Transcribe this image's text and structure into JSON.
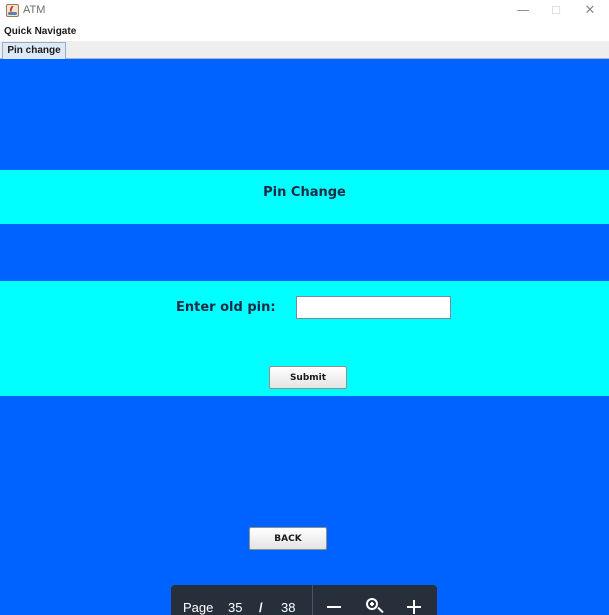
{
  "window": {
    "title": "ATM",
    "minimize_icon": "minimize-icon",
    "maximize_icon": "maximize-icon",
    "close_icon": "close-icon"
  },
  "menu": {
    "items": [
      "Quick Navigate"
    ]
  },
  "tabs": [
    {
      "label": "Pin change",
      "selected": true
    }
  ],
  "page": {
    "heading": "Pin Change",
    "pin_label": "Enter old pin:",
    "pin_value": "",
    "submit_label": "Submit",
    "back_label": "BACK"
  },
  "pdf_toolbar": {
    "page_label": "Page",
    "current_page": "35",
    "separator": "/",
    "total_pages": "38",
    "icons": [
      "zoom-out-icon",
      "zoom-icon",
      "zoom-in-icon"
    ]
  },
  "colors": {
    "background": "#0063ff",
    "band": "#00ffff",
    "toolbar": "#272f3b"
  }
}
